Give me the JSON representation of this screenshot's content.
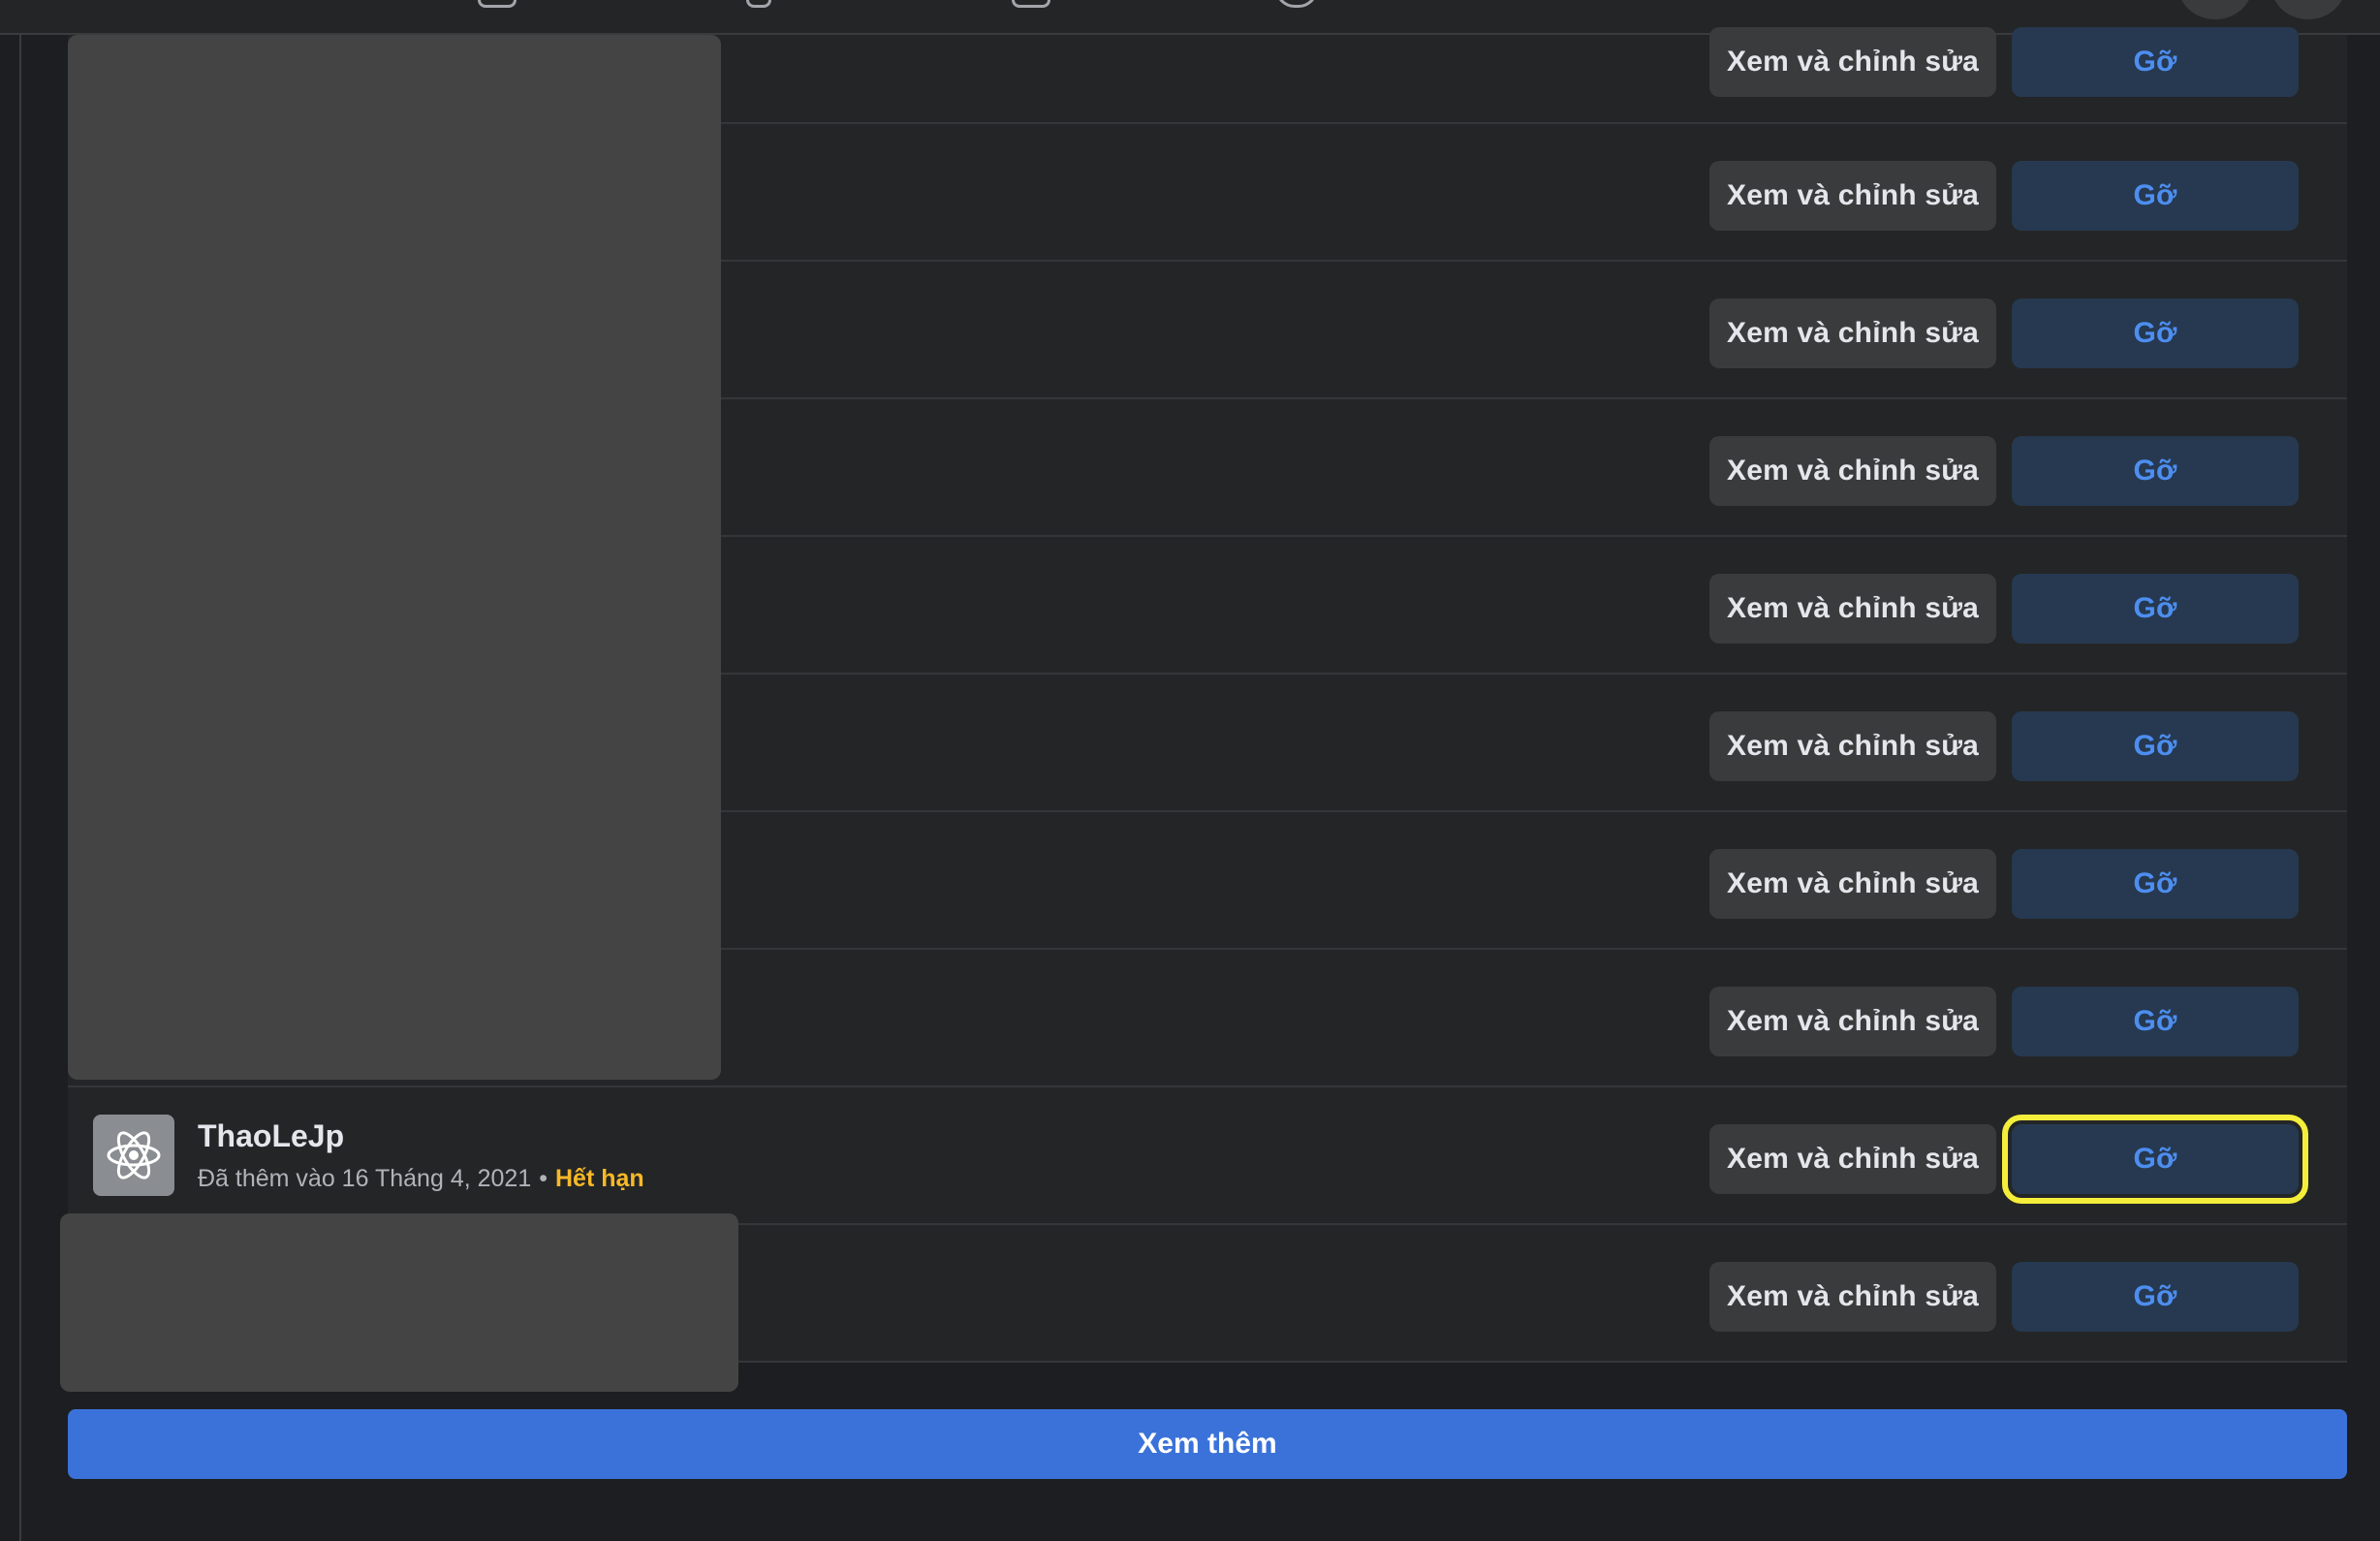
{
  "apps": {
    "edit_label": "Xem và chỉnh sửa",
    "remove_label": "Gỡ",
    "visible_app": {
      "name": "ThaoLeJp",
      "added": "Đã thêm vào 16 Tháng 4, 2021",
      "separator": "•",
      "status": "Hết hạn"
    }
  },
  "footer": {
    "see_more_label": "Xem thêm"
  },
  "colors": {
    "page_bg": "#1c1e21",
    "panel_bg": "#242526",
    "edit_btn_bg": "#3a3b3c",
    "remove_btn_bg": "#263951",
    "remove_btn_text": "#4d8ef0",
    "expired_text": "#f7b928",
    "see_more_bg": "#3b72d9",
    "highlight_outline": "#f4ee3a"
  },
  "icons": {
    "app_icon": "atom-icon"
  }
}
